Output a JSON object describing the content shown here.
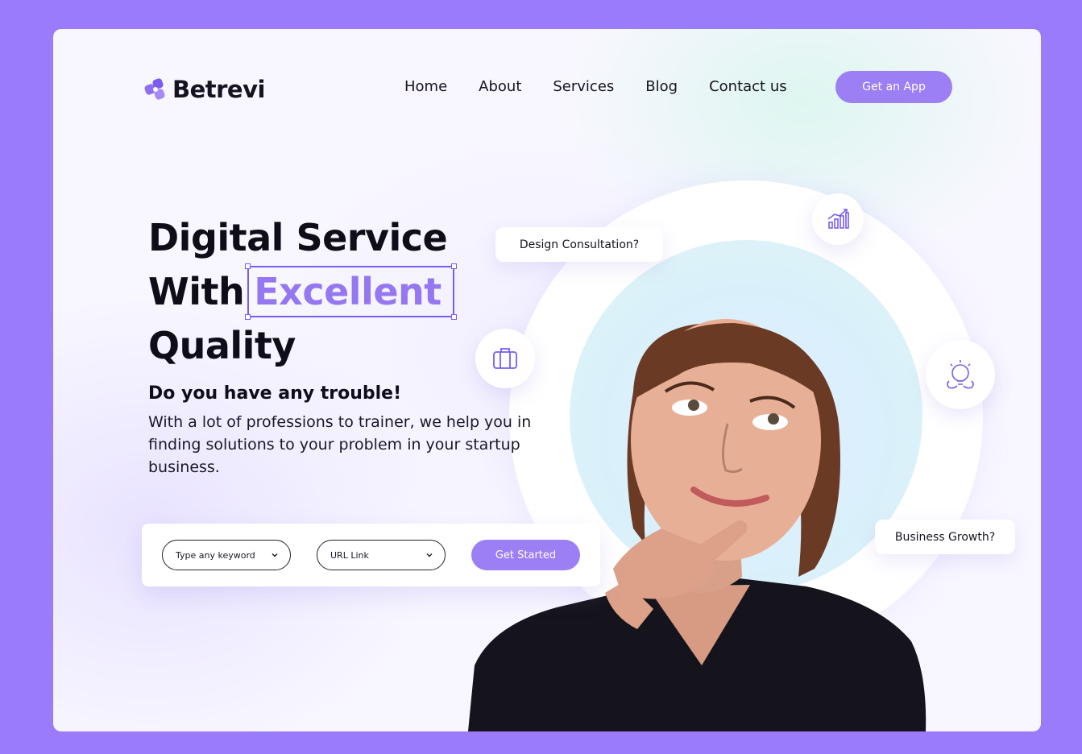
{
  "brand": {
    "name": "Betrevi"
  },
  "nav": {
    "items": [
      "Home",
      "About",
      "Services",
      "Blog",
      "Contact us"
    ],
    "cta": "Get an App"
  },
  "hero": {
    "title_line1": "Digital Service",
    "title_line2_prefix": "With",
    "title_highlight": "Excellent",
    "title_line3": "Quality",
    "subhead": "Do you have any trouble!",
    "description": "With a lot of professions to trainer, we help you in finding solutions to your problem in your startup business."
  },
  "search": {
    "keyword_select": "Type any keyword",
    "url_select": "URL Link",
    "submit": "Get Started"
  },
  "bubbles": {
    "design": "Design Consultation?",
    "growth": "Business Growth?"
  },
  "icons": [
    "chart-growth-icon",
    "briefcase-icon",
    "lightbulb-brain-icon"
  ],
  "colors": {
    "accent": "#9d7ff5",
    "page_bg": "#9a7cfb",
    "text": "#15131f"
  }
}
